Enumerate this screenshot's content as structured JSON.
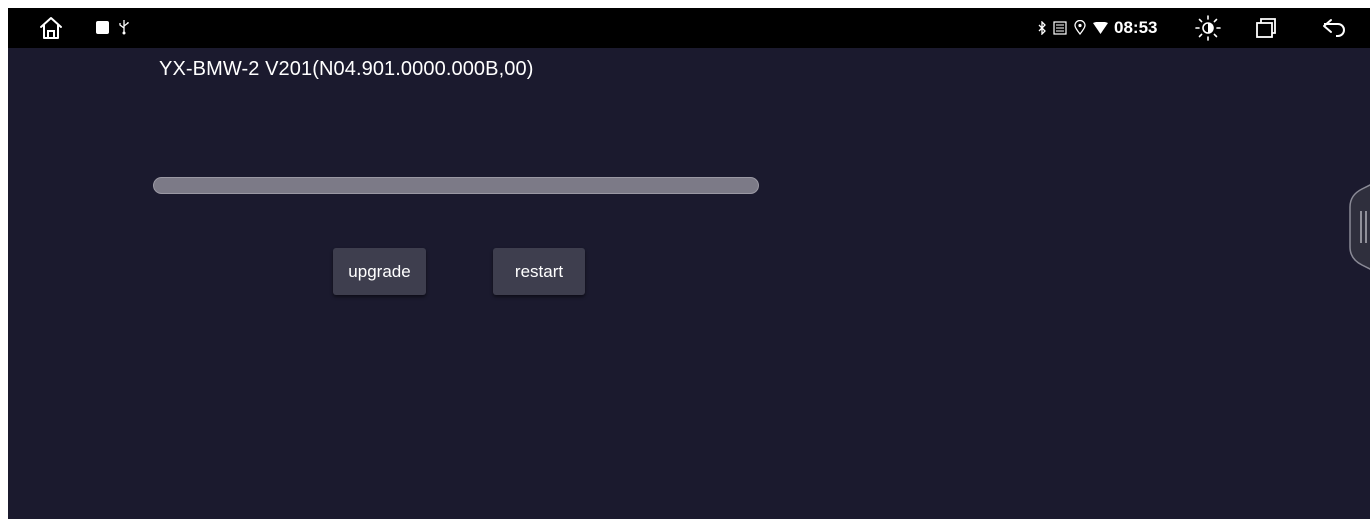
{
  "status_bar": {
    "time": "08:53",
    "left_icons": [
      "home-icon",
      "notification-square-icon",
      "usb-icon"
    ],
    "right_icons": [
      "bluetooth-icon",
      "sim-icon",
      "location-icon",
      "wifi-icon",
      "brightness-icon",
      "recents-icon",
      "back-icon"
    ]
  },
  "main": {
    "version_text": "YX-BMW-2 V201(N04.901.0000.000B,00)",
    "progress": 0,
    "buttons": {
      "upgrade_label": "upgrade",
      "restart_label": "restart"
    }
  },
  "colors": {
    "background": "#1b1a2e",
    "status_bar": "#000000",
    "button_bg": "#3e3e4e",
    "progress_track": "#7c7a87"
  }
}
